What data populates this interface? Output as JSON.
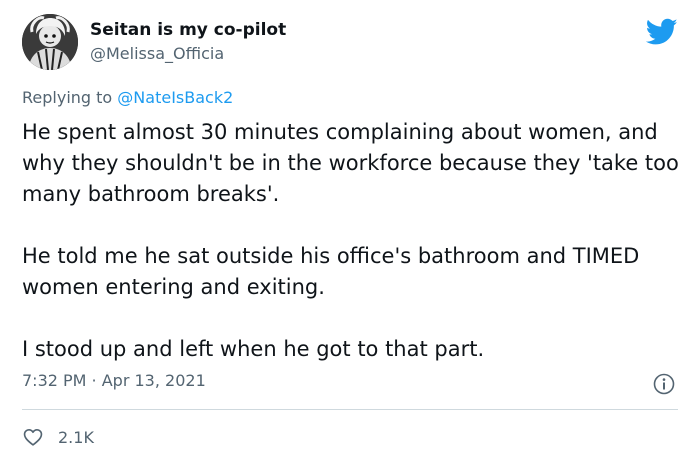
{
  "author": {
    "display_name": "Seitan is my co-pilot",
    "handle": "@Melissa_Officia",
    "avatar_icon": "avatar-image"
  },
  "brand": {
    "icon": "twitter-bird-icon",
    "color": "#1d9bf0"
  },
  "reply": {
    "prefix": "Replying to",
    "mention": "@NateIsBack2"
  },
  "tweet": {
    "paragraphs": [
      "He spent almost 30 minutes complaining about women, and why they shouldn't be in the workforce because they 'take too many bathroom breaks'.",
      "He told me he sat outside his office's bathroom and TIMED women entering and exiting.",
      "I stood up and left when he got to that part."
    ],
    "timestamp": "7:32 PM · Apr 13, 2021"
  },
  "actions": {
    "like_icon": "heart-icon",
    "like_count": "2.1K",
    "info_icon": "info-icon"
  },
  "colors": {
    "text": "#0f1419",
    "secondary": "#536471",
    "link": "#1d9bf0",
    "divider": "#cfd9de"
  }
}
